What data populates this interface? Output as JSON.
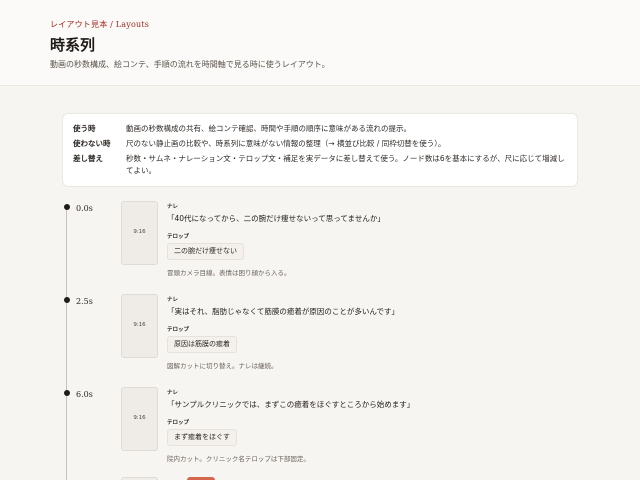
{
  "header": {
    "breadcrumb": "レイアウト見本 / Layouts",
    "title": "時系列",
    "subtitle": "動画の秒数構成、絵コンテ、手順の流れを時間軸で見る時に使うレイアウト。"
  },
  "info": [
    {
      "key": "使う時",
      "value": "動画の秒数構成の共有、絵コンテ確認、時間や手順の順序に意味がある流れの提示。"
    },
    {
      "key": "使わない時",
      "value": "尺のない静止画の比較や、時系列に意味がない情報の整理（→ 横並び比較 / 同枠切替を使う）。"
    },
    {
      "key": "差し替え",
      "value": "秒数・サムネ・ナレーション文・テロップ文・補足を実データに差し替えて使う。ノード数は6を基本にするが、尺に応じて増減してよい。"
    }
  ],
  "labels": {
    "narration": "ナレ",
    "telop": "テロップ"
  },
  "timeline": [
    {
      "time": "0.0s",
      "thumb": "9:16",
      "narration": "「40代になってから、二の腕だけ痩せないって思ってませんか」",
      "telop": "二の腕だけ痩せない",
      "note": "冒頭カメラ目線。表情は困り顔から入る。"
    },
    {
      "time": "2.5s",
      "thumb": "9:16",
      "narration": "「実はそれ、脂肪じゃなくて筋膜の癒着が原因のことが多いんです」",
      "telop": "原因は筋膜の癒着",
      "note": "図解カットに切り替え。ナレは継続。"
    },
    {
      "time": "6.0s",
      "thumb": "9:16",
      "narration": "「サンプルクリニックでは、まずこの癒着をほぐすところから始めます」",
      "telop": "まず癒着をほぐす",
      "note": "院内カット。クリニック名テロップは下部固定。"
    }
  ],
  "colors": {
    "accent": "#a3291f",
    "background": "#f7f5f1",
    "card": "#ffffff",
    "peek": "#d4674d"
  }
}
